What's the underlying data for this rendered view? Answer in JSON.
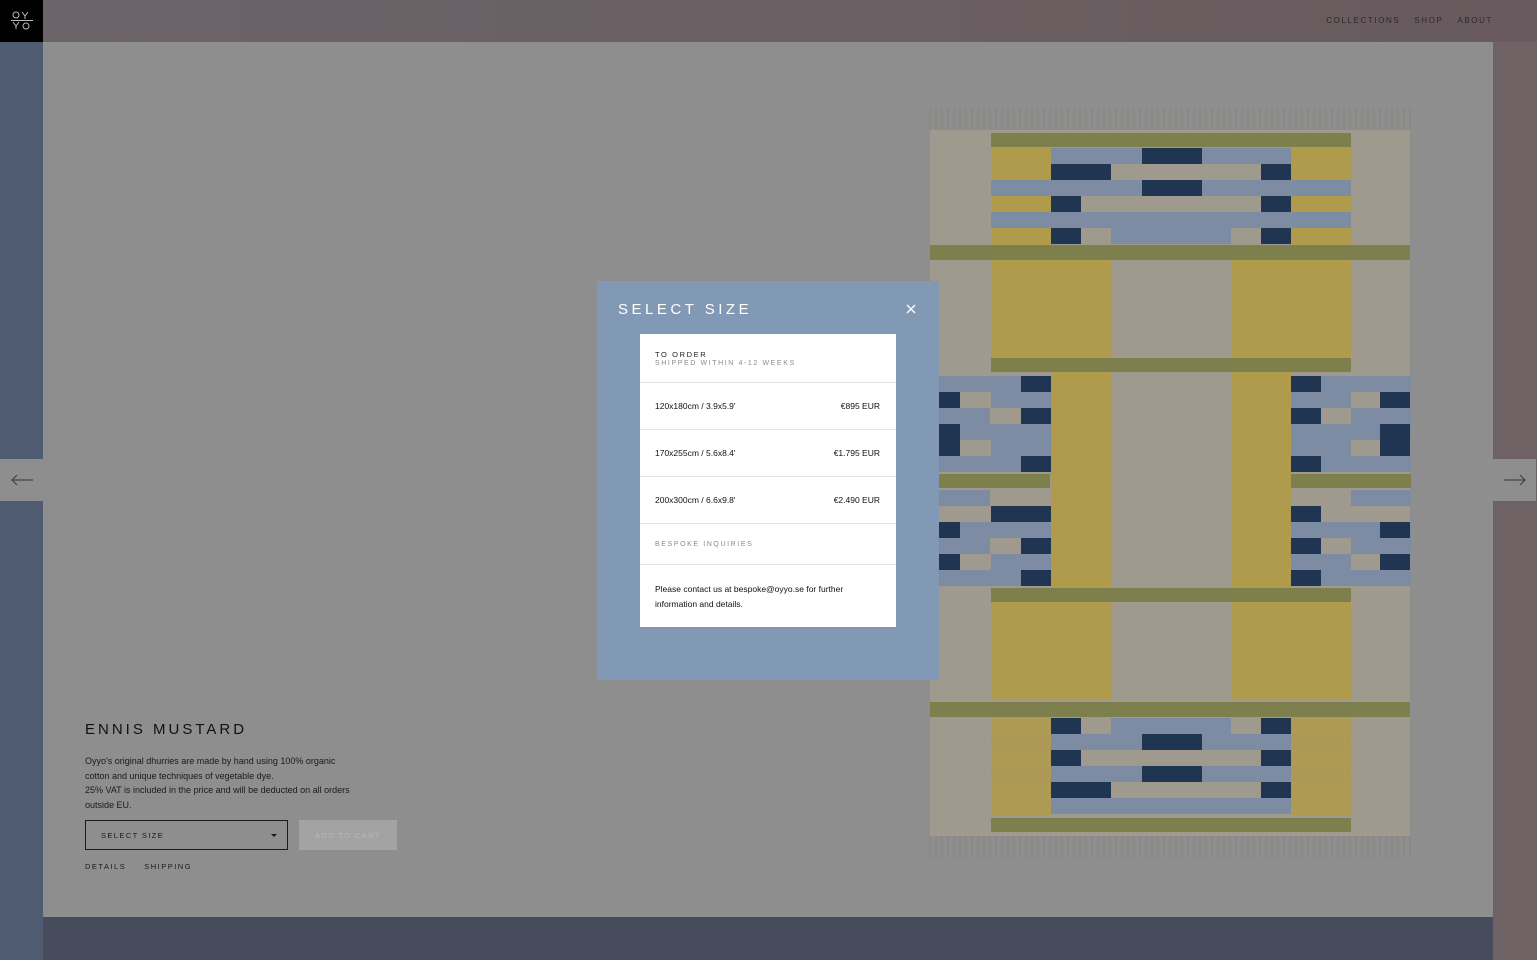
{
  "nav": {
    "items": [
      "COLLECTIONS",
      "SHOP",
      "ABOUT"
    ]
  },
  "product": {
    "title": "ENNIS MUSTARD",
    "description_1": "Oyyo's original dhurries are made by hand using 100% organic cotton and unique techniques of vegetable dye.",
    "description_2": "25% VAT is included in the price and will be deducted on all orders outside EU.",
    "select_label": "SELECT SIZE",
    "add_to_cart_label": "ADD TO CART",
    "links": [
      "DETAILS",
      "SHIPPING"
    ]
  },
  "modal": {
    "title": "SELECT SIZE",
    "order_heading": "TO ORDER",
    "order_subheading": "SHIPPED WITHIN 4-12 WEEKS",
    "sizes": [
      {
        "size": "120x180cm / 3.9x5.9'",
        "price": "€895 EUR"
      },
      {
        "size": "170x255cm / 5.6x8.4'",
        "price": "€1.795 EUR"
      },
      {
        "size": "200x300cm / 6.6x9.8'",
        "price": "€2.490 EUR"
      }
    ],
    "bespoke_heading": "BESPOKE INQUIRIES",
    "contact_text": "Please contact us at bespoke@oyyo.se for further information and details."
  },
  "colors": {
    "overlay": "#8e8e8e",
    "modal_bg": "#8199b5",
    "rug_mustard": "#b09a4c",
    "rug_navy": "#1f3552",
    "rug_blue": "#7e8ca3",
    "rug_olive": "#7d7f4c",
    "rug_beige": "#a49c8c"
  }
}
